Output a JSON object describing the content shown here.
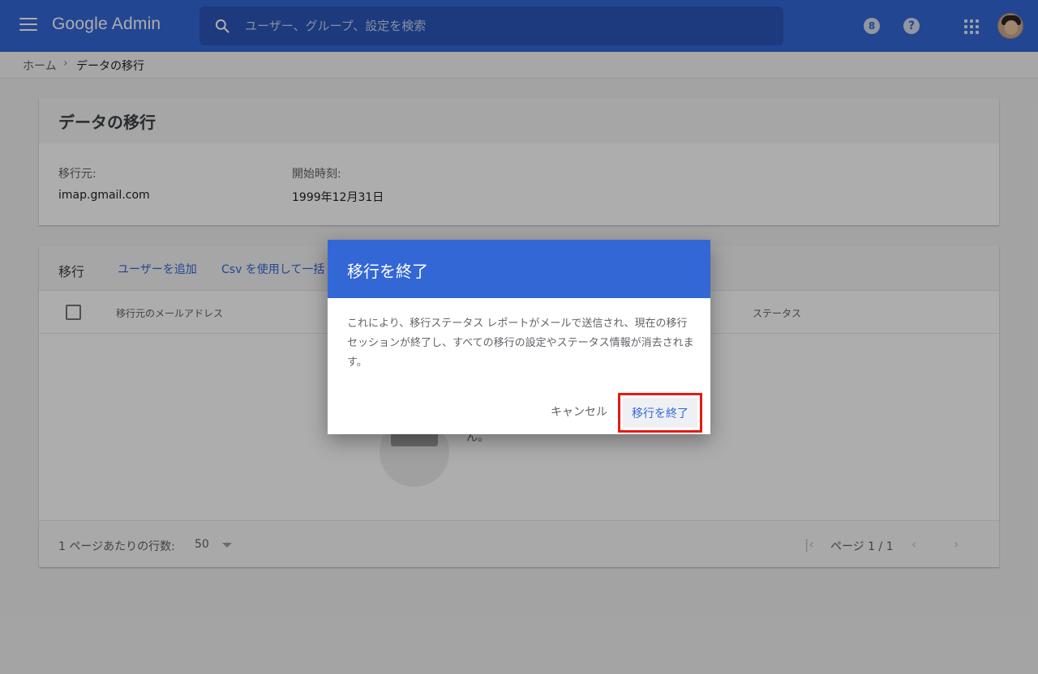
{
  "topbar": {
    "logo": "Google Admin",
    "search_placeholder": "ユーザー、グループ、設定を検索",
    "badge_number": "8",
    "help_symbol": "?"
  },
  "breadcrumb": {
    "home": "ホーム",
    "separator": "›",
    "current": "データの移行"
  },
  "migration_card": {
    "title": "データの移行",
    "source_label": "移行元:",
    "source_value": "imap.gmail.com",
    "start_label": "開始時刻:",
    "start_value": "1999年12月31日"
  },
  "users_card": {
    "toolbar_title": "移行",
    "add_user": "ユーザーを追加",
    "csv_bulk": "Csv を使用して一括",
    "col_email": "移行元のメールアドレス",
    "col_status": "ステータス",
    "empty_text": "ん。",
    "rows_per_page_label": "1 ページあたりの行数:",
    "rows_per_page_value": "50",
    "page_text": "ページ 1 / 1",
    "first_page": "|‹",
    "prev_page": "‹",
    "next_page": "›"
  },
  "dialog": {
    "title": "移行を終了",
    "body": "これにより、移行ステータス レポートがメールで送信され、現在の移行セッションが終了し、すべての移行の設定やステータス情報が消去されます。",
    "cancel": "キャンセル",
    "confirm": "移行を終了"
  },
  "colors": {
    "brand_blue": "#3367d6",
    "highlight_red": "#e8190f"
  }
}
